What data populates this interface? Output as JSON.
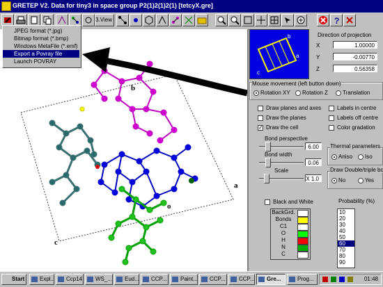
{
  "window": {
    "title": "GRETEP V2. Data for      tiny3 in space group P2(1)2(1)2(1) [tetcyX.gre]"
  },
  "toolbar": {
    "view_button": "3.View"
  },
  "menu": {
    "items": [
      "JPEG format (*.jpg)",
      "Bitmap format (*.bmp)",
      "Windows MetaFile (*.emf)",
      "Export a Povray file",
      "Launch POVRAY"
    ],
    "selected": 3
  },
  "canvas": {
    "labels": {
      "a": "a",
      "b": "b",
      "c": "c",
      "o": "o"
    }
  },
  "projection": {
    "title": "Direction of projection",
    "x_label": "X",
    "x": "1.00000",
    "y_label": "Y",
    "y": "-0.00770",
    "z_label": "Z",
    "z": "0.56358",
    "inset_labels": {
      "a": "a",
      "b": "b",
      "c": "c"
    }
  },
  "mouse": {
    "title": "Mouse movement (left button down)",
    "options": [
      "Rotation XY",
      "Rotation Z",
      "Translation"
    ],
    "selected": 0
  },
  "checks": {
    "left": [
      {
        "label": "Draw planes and axes",
        "checked": false
      },
      {
        "label": "Draw the planes",
        "checked": false
      },
      {
        "label": "Draw the cell",
        "checked": true
      }
    ],
    "right": [
      {
        "label": "Labels in centre",
        "checked": false
      },
      {
        "label": "Labels off centre",
        "checked": false
      },
      {
        "label": "Color gradation",
        "checked": false
      }
    ]
  },
  "sliders": {
    "bond_perspective": {
      "label": "Bond perspective",
      "value": "6.00",
      "fraction": 0.15
    },
    "bond_width": {
      "label": "Bond width",
      "value": "0.06",
      "fraction": 0.15
    },
    "scale": {
      "label": "Scale",
      "value": "X 1.0",
      "fraction": 0.12
    }
  },
  "thermal": {
    "title": "Thermal parameters",
    "options": [
      "Aniso",
      "Iso"
    ],
    "selected": 0
  },
  "double_bond": {
    "title": "Draw Double/triple bo",
    "options": [
      "No",
      "Yes"
    ],
    "selected": 0
  },
  "bw": {
    "label": "Black and White",
    "checked": false
  },
  "colors": {
    "rows": [
      {
        "label": "BackGrd.",
        "color": "#ffffff"
      },
      {
        "label": "Bonds",
        "color": "#ffff00"
      },
      {
        "label": "C1",
        "color": "#ffffff"
      },
      {
        "label": "O",
        "color": "#00ff00"
      },
      {
        "label": "H",
        "color": "#ff0000"
      },
      {
        "label": "N",
        "color": "#00b000"
      },
      {
        "label": "C",
        "color": "#ffffff"
      }
    ]
  },
  "probability": {
    "label": "Probability (%)",
    "items": [
      "10",
      "20",
      "30",
      "40",
      "50",
      "60",
      "70",
      "80",
      "90"
    ],
    "selected": 5
  },
  "taskbar": {
    "start": "Start",
    "tasks": [
      "Expl...",
      "Ccp14",
      "WS_...",
      "Eud...",
      "CCP...",
      "Paint...",
      "CCP...",
      "CCP...",
      "Gre...",
      "Prog..."
    ],
    "active": 8,
    "clock": "01:48"
  },
  "colors_theme": {
    "title_bar": "#000080",
    "window_bg": "#c0c0c0",
    "selection": "#000080",
    "arrow": "#000000"
  }
}
